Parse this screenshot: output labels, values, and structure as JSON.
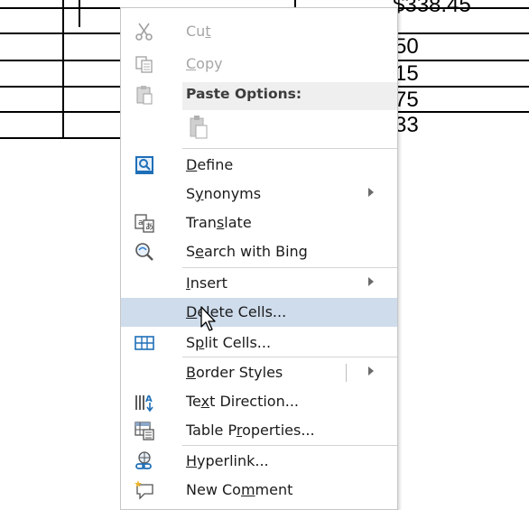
{
  "document": {
    "cell_values": [
      "$338.45",
      "50",
      "15",
      "75",
      "33"
    ]
  },
  "menu": {
    "cut": {
      "prefix": "Cu",
      "underline": "t",
      "suffix": "",
      "icon": "scissors-icon"
    },
    "copy": {
      "prefix": "",
      "underline": "C",
      "suffix": "opy",
      "icon": "copy-icon"
    },
    "paste_header": "Paste Options:",
    "paste_icon": "clipboard-paste-icon",
    "define": {
      "prefix": "",
      "underline": "D",
      "suffix": "efine",
      "icon": "define-search-icon"
    },
    "synonyms": {
      "prefix": "S",
      "underline": "y",
      "suffix": "nonyms"
    },
    "translate": {
      "prefix": "Tran",
      "underline": "s",
      "suffix": "late",
      "icon": "translate-icon"
    },
    "search": {
      "prefix": "S",
      "underline": "e",
      "suffix": "arch with Bing",
      "icon": "search-bing-icon"
    },
    "insert": {
      "prefix": "",
      "underline": "I",
      "suffix": "nsert"
    },
    "delete_cells": {
      "prefix": "",
      "underline": "D",
      "suffix": "elete Cells..."
    },
    "split_cells": {
      "prefix": "S",
      "underline": "p",
      "suffix": "lit Cells...",
      "icon": "split-cells-icon"
    },
    "border_styles": {
      "prefix": "",
      "underline": "B",
      "suffix": "order Styles"
    },
    "text_direction": {
      "prefix": "Te",
      "underline": "x",
      "suffix": "t Direction...",
      "icon": "text-direction-icon"
    },
    "table_properties": {
      "prefix": "Table P",
      "underline": "r",
      "suffix": "operties...",
      "icon": "table-properties-icon"
    },
    "hyperlink": {
      "prefix": "",
      "underline": "H",
      "suffix": "yperlink...",
      "icon": "hyperlink-icon"
    },
    "new_comment": {
      "prefix": "New Co",
      "underline": "m",
      "suffix": "ment",
      "icon": "new-comment-icon"
    }
  },
  "colors": {
    "hover_bg": "#cfdcec",
    "disabled_text": "#a6a6a6",
    "accent_blue": "#1e6fb8"
  }
}
